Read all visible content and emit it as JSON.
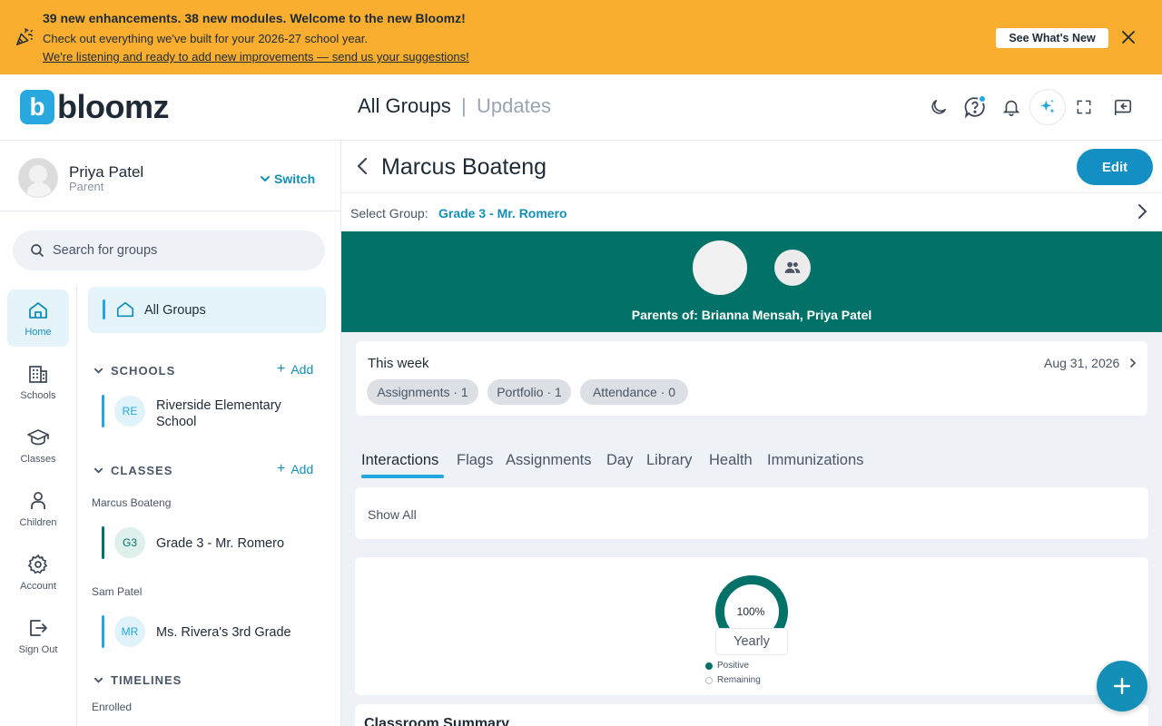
{
  "banner": {
    "title": "39 new enhancements. 38 new modules. Welcome to the new Bloomz!",
    "subtitle": "Check out everything we've built for your 2026-27 school year.",
    "link": "We're listening and ready to add new improvements — send us your suggestions!",
    "button": "See What's New",
    "icon": "party-popper-icon",
    "color": "#f9ae2f"
  },
  "header": {
    "logo_letter": "b",
    "logo_text": "bloomz",
    "title": "All Groups",
    "separator": "|",
    "subtitle": "Updates"
  },
  "profile": {
    "name": "Priya Patel",
    "role": "Parent",
    "switch_label": "Switch"
  },
  "search": {
    "placeholder": "Search for groups"
  },
  "rail": [
    {
      "label": "Home",
      "icon": "home-icon",
      "active": true
    },
    {
      "label": "Schools",
      "icon": "building-icon"
    },
    {
      "label": "Classes",
      "icon": "graduation-cap-icon"
    },
    {
      "label": "Children",
      "icon": "person-icon"
    },
    {
      "label": "Account",
      "icon": "gear-icon"
    },
    {
      "label": "Sign Out",
      "icon": "sign-out-icon"
    }
  ],
  "groups": {
    "all_groups": "All Groups",
    "schools_header": "SCHOOLS",
    "add_label": "Add",
    "school": {
      "initials": "RE",
      "name_line1": "Riverside Elementary",
      "name_line2": "School"
    },
    "classes_header": "CLASSES",
    "class_groups": [
      {
        "child": "Marcus Boateng",
        "initials": "G3",
        "name": "Grade 3 - Mr. Romero"
      },
      {
        "child": "Sam Patel",
        "initials": "MR",
        "name": "Ms. Rivera's 3rd Grade"
      }
    ],
    "timelines_header": "TIMELINES",
    "timelines_sub": "Enrolled"
  },
  "main": {
    "student_name": "Marcus Boateng",
    "edit_label": "Edit",
    "select_group_label": "Select Group:",
    "select_group_value": "Grade 3 - Mr. Romero",
    "parents_text": "Parents of: Brianna Mensah, Priya Patel",
    "hero_color": "#027268",
    "week": {
      "title": "This week",
      "date": "Aug 31, 2026",
      "chips": [
        "Assignments · 1",
        "Portfolio · 1",
        "Attendance · 0"
      ]
    },
    "tabs": [
      "Interactions",
      "Flags",
      "Assignments",
      "Day",
      "Library",
      "Health",
      "Immunizations"
    ],
    "show_all": "Show All",
    "donut": {
      "percent_label": "100%",
      "positive": 100,
      "period": "Yearly",
      "legend": [
        "Positive",
        "Remaining"
      ]
    },
    "summary_title": "Classroom Summary"
  }
}
